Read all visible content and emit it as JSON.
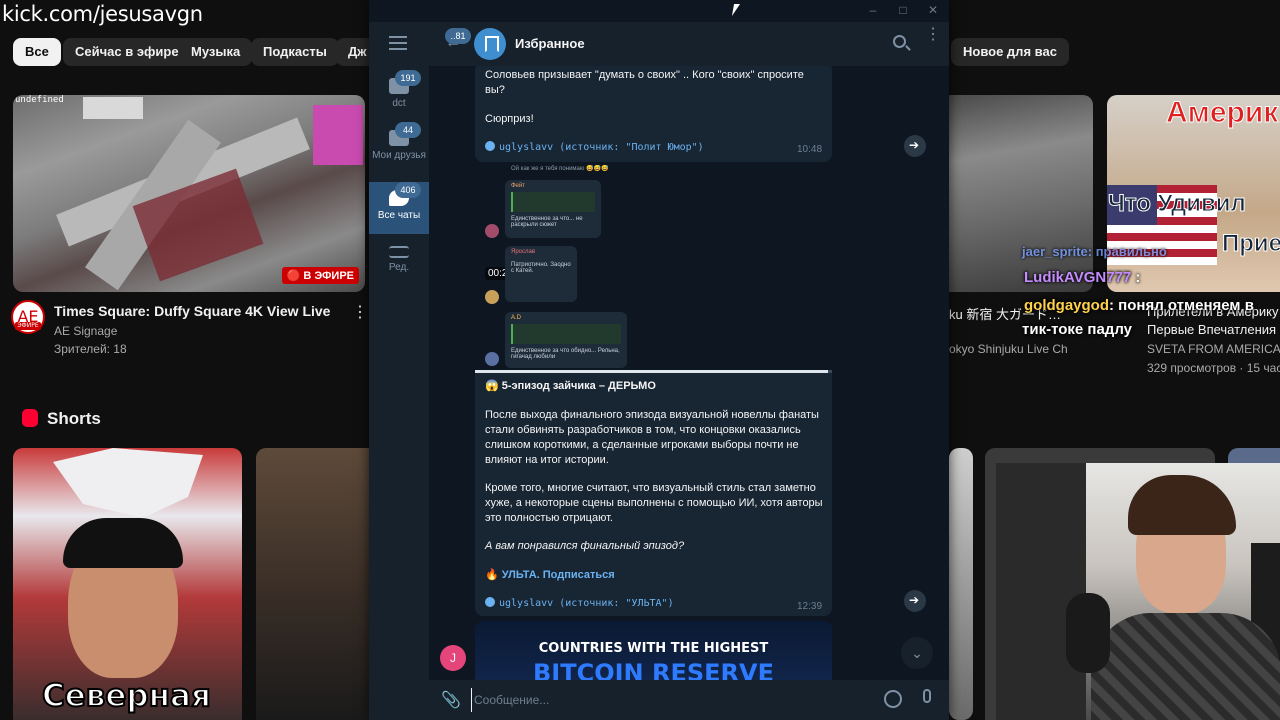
{
  "stream_overlay": {
    "url": "kick.com/jesusavgn"
  },
  "youtube": {
    "chips": [
      "Все",
      "Сейчас в эфире",
      "Музыка",
      "Подкасты",
      "Дж",
      "Новое для вас"
    ],
    "featured_video": {
      "thumb_label": "undefined",
      "live_badge": "🔴 В ЭФИРЕ",
      "channel_avatar_text": "AE",
      "channel_avatar_sub": "ЭФИРЕ",
      "title": "Times Square: Duffy Square 4K View Live",
      "channel": "AE Signage",
      "viewers": "Зрителей: 18",
      "more": "⋮"
    },
    "right_videos": {
      "title1": "ku 新宿 大ガード…",
      "channel1": "okyo Shinjuku Live Ch",
      "title2": "Прилетели в Америку",
      "title2b": "Первые Впечатления",
      "channel2": "SVETA FROM AMERICA",
      "stats2": "329 просмотров · 15 час",
      "thumb_text_top": "Америк",
      "thumb_text_mid": "Что Удивил",
      "thumb_text_bot": "Прие"
    },
    "shorts": {
      "title": "Shorts",
      "short1_caption": "Северная"
    }
  },
  "stream_chat": [
    {
      "user": "jaer_sprite",
      "text": ": правильно"
    },
    {
      "user": "LudikAVGN777",
      "text": " :"
    },
    {
      "user": "goldgaygod",
      "text": ": понял отменяем в"
    },
    {
      "user": "",
      "text": "тик-токе падлу"
    }
  ],
  "telegram": {
    "sidebar": {
      "folders": [
        {
          "label": "dct",
          "badge": "191"
        },
        {
          "label": "Мои друзья",
          "badge": "44"
        },
        {
          "label": "Все чаты",
          "badge": "406"
        },
        {
          "label": "Ред.",
          "badge": ""
        }
      ]
    },
    "header": {
      "back_badge": "..81",
      "title": "Избранное"
    },
    "messages": {
      "msg1": {
        "line1": "Соловьев призывает \"думать о своих\" .. Кого \"своих\" спросите",
        "line2": "вы?",
        "line3": "Сюрприз!",
        "signature": "uglyslavv (источник: \"Полит Юмор\")",
        "time": "10:48"
      },
      "video": {
        "duration": "00:26",
        "mute_icon": "🔇",
        "progress": 0.99,
        "mini_msgs": [
          {
            "name": "Ой как же я тебя понимаю 😅😅😅",
            "text": "",
            "time": "4:25"
          },
          {
            "name": "Фейт",
            "text": "Единственное за что... не раскрыли сюжет",
            "time": "4:25"
          },
          {
            "name": "Ярослав",
            "text": "Патриотично. Заодно с Катей.",
            "time": "4:25"
          },
          {
            "name": "A.D",
            "text": "Единственное за что обидно... Рельна, гигачад любили",
            "time": "4:25"
          }
        ]
      },
      "msg2": {
        "title": "😱 5-эпизод зайчика – ДЕРЬМО",
        "p1": "После выхода финального эпизода визуальной новеллы фанаты стали обвинять разработчиков в том, что концовки оказались слишком короткими, а сделанные игроками выборы почти не влияют на итог истории.",
        "p2": "Кроме того, многие считают, что визуальный стиль стал заметно хуже, а некоторые сцены выполнены с помощью ИИ, хотя авторы это полностью отрицают.",
        "p3": "А вам понравился финальный эпизод?",
        "link": "🔥 УЛЬТА. Подписаться",
        "signature": "uglyslavv (источник: \"УЛЬТА\")",
        "time": "12:39"
      },
      "msg3": {
        "line1": "COUNTRIES WITH THE HIGHEST",
        "line2": "BITCOIN RESERVE"
      }
    },
    "unread_avatar": "J",
    "composer": {
      "placeholder": "Сообщение..."
    }
  }
}
